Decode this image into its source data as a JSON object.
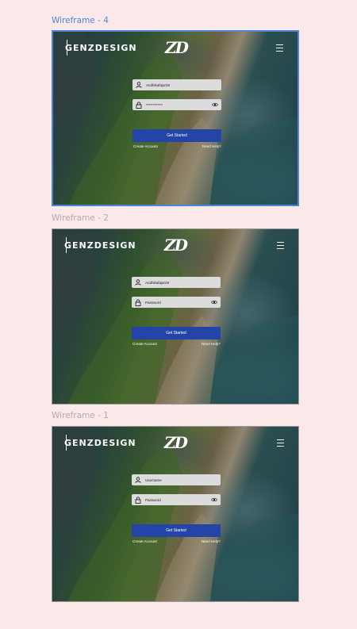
{
  "frames": [
    {
      "label": "Wireframe - 4",
      "brand": "GENZDESIGN",
      "logo": "ZD",
      "menu_icon": "hamburger-icon",
      "username_value": "Andhikafajar29",
      "password_value": "************",
      "button_label": "Get Started",
      "create_account": "Create Account",
      "need_help": "Need Help?"
    },
    {
      "label": "Wireframe - 2",
      "brand": "GENZDESIGN",
      "logo": "ZD",
      "menu_icon": "hamburger-icon",
      "username_value": "Andhikafajar29",
      "password_value": "Password",
      "button_label": "Get Started",
      "create_account": "Create Account",
      "need_help": "Need Help?"
    },
    {
      "label": "Wireframe - 1",
      "brand": "GENZDESIGN",
      "logo": "ZD",
      "menu_icon": "hamburger-icon",
      "username_value": "Username",
      "password_value": "Password",
      "button_label": "Get Started",
      "create_account": "Create Account",
      "need_help": "Need Help?"
    }
  ],
  "colors": {
    "canvas_bg": "#fbe8e8",
    "selected_border": "#4a86d8",
    "button_bg": "#2444a8",
    "field_bg": "#dcdcdc"
  }
}
